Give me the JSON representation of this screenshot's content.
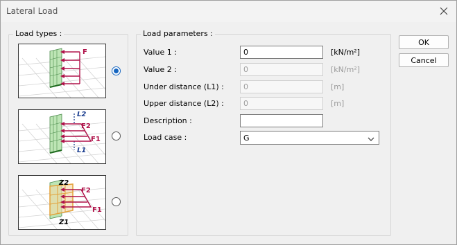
{
  "window": {
    "title": "Lateral Load"
  },
  "load_types": {
    "legend": "Load types :",
    "options": [
      {
        "name": "uniform",
        "selected": true,
        "labels": [
          "F"
        ]
      },
      {
        "name": "two-forces-distance",
        "selected": false,
        "labels": [
          "L2",
          "F2",
          "F1",
          "L1"
        ]
      },
      {
        "name": "two-forces-levels",
        "selected": false,
        "labels": [
          "Z2",
          "F2",
          "F1",
          "Z1"
        ]
      }
    ]
  },
  "params": {
    "legend": "Load parameters :",
    "value1": {
      "label": "Value 1 :",
      "value": "0",
      "unit": "[kN/m²]"
    },
    "value2": {
      "label": "Value 2 :",
      "value": "0",
      "unit": "[kN/m²]"
    },
    "l1": {
      "label": "Under distance (L1) :",
      "value": "0",
      "unit": "[m]"
    },
    "l2": {
      "label": "Upper distance (L2) :",
      "value": "0",
      "unit": "[m]"
    },
    "description": {
      "label": "Description :",
      "value": ""
    },
    "load_case": {
      "label": "Load case :",
      "value": "G"
    }
  },
  "buttons": {
    "ok": "OK",
    "cancel": "Cancel"
  },
  "colors": {
    "accent": "#1565c0",
    "force": "#b0124a",
    "wall_green": "#bde5b5",
    "wall_orange": "#e3a23a",
    "dim_blue": "#1a3d8f"
  }
}
